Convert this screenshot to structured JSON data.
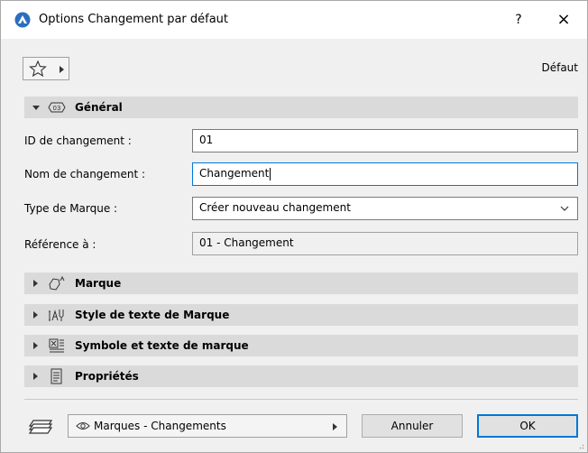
{
  "window": {
    "title": "Options Changement par défaut",
    "help_label": "?",
    "close_label": "×"
  },
  "toolbar": {
    "favorites_icon": "star-icon",
    "default_label": "Défaut"
  },
  "general": {
    "title": "Général",
    "badge": "03",
    "fields": {
      "change_id": {
        "label": "ID de changement :",
        "value": "01"
      },
      "change_name": {
        "label": "Nom de changement :",
        "value": "Changement"
      },
      "marker_type": {
        "label": "Type de Marque :",
        "value": "Créer nouveau changement"
      },
      "reference": {
        "label": "Référence à :",
        "value": "01 - Changement"
      }
    }
  },
  "sections": {
    "marker": "Marque",
    "marker_text_style": "Style de texte de Marque",
    "symbol_text": "Symbole et texte de marque",
    "properties": "Propriétés"
  },
  "footer": {
    "layer": "Marques - Changements",
    "cancel_label": "Annuler",
    "ok_label": "OK"
  },
  "colors": {
    "accent": "#0078d7",
    "section_bg": "#dadada",
    "dialog_bg": "#f0f0f0"
  }
}
